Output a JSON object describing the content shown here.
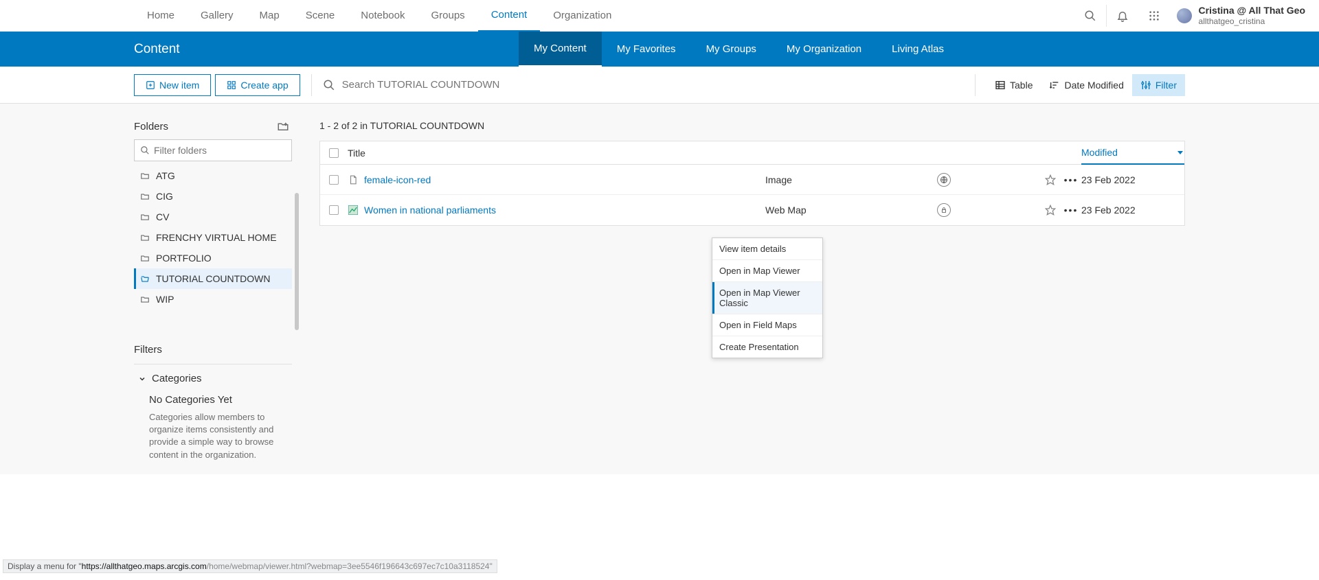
{
  "topnav": {
    "links": [
      "Home",
      "Gallery",
      "Map",
      "Scene",
      "Notebook",
      "Groups",
      "Content",
      "Organization"
    ],
    "active_index": 6
  },
  "user": {
    "line1": "Cristina @ All That Geo",
    "line2": "allthatgeo_cristina"
  },
  "subhead": {
    "title": "Content",
    "tabs": [
      "My Content",
      "My Favorites",
      "My Groups",
      "My Organization",
      "Living Atlas"
    ],
    "active_index": 0
  },
  "toolbar": {
    "new_item": "New item",
    "create_app": "Create app",
    "search_placeholder": "Search TUTORIAL COUNTDOWN",
    "table": "Table",
    "date_modified": "Date Modified",
    "filter": "Filter"
  },
  "sidebar": {
    "folders_label": "Folders",
    "filter_placeholder": "Filter folders",
    "folders": [
      "ATG",
      "CIG",
      "CV",
      "FRENCHY VIRTUAL HOME",
      "PORTFOLIO",
      "TUTORIAL COUNTDOWN",
      "WIP"
    ],
    "selected_index": 5,
    "filters_label": "Filters",
    "categories_label": "Categories",
    "cat_empty_title": "No Categories Yet",
    "cat_empty_body": "Categories allow members to organize items consistently and provide a simple way to browse content in the organization."
  },
  "main": {
    "count_line": "1 - 2 of 2 in TUTORIAL COUNTDOWN",
    "columns": {
      "title": "Title",
      "modified": "Modified"
    },
    "rows": [
      {
        "title": "female-icon-red",
        "type": "Image",
        "share": "public",
        "date": "23 Feb 2022"
      },
      {
        "title": "Women in national parliaments",
        "type": "Web Map",
        "share": "owner",
        "date": "23 Feb 2022"
      }
    ]
  },
  "context_menu": {
    "items": [
      "View item details",
      "Open in Map Viewer",
      "Open in Map Viewer Classic",
      "Open in Field Maps",
      "Create Presentation"
    ],
    "hover_index": 2
  },
  "statusbar": {
    "prefix": "Display a menu for \"",
    "url_bold": "https://allthatgeo.maps.arcgis.com",
    "url_tail": "/home/webmap/viewer.html?webmap=3ee5546f196643c697ec7c10a3118524\""
  }
}
